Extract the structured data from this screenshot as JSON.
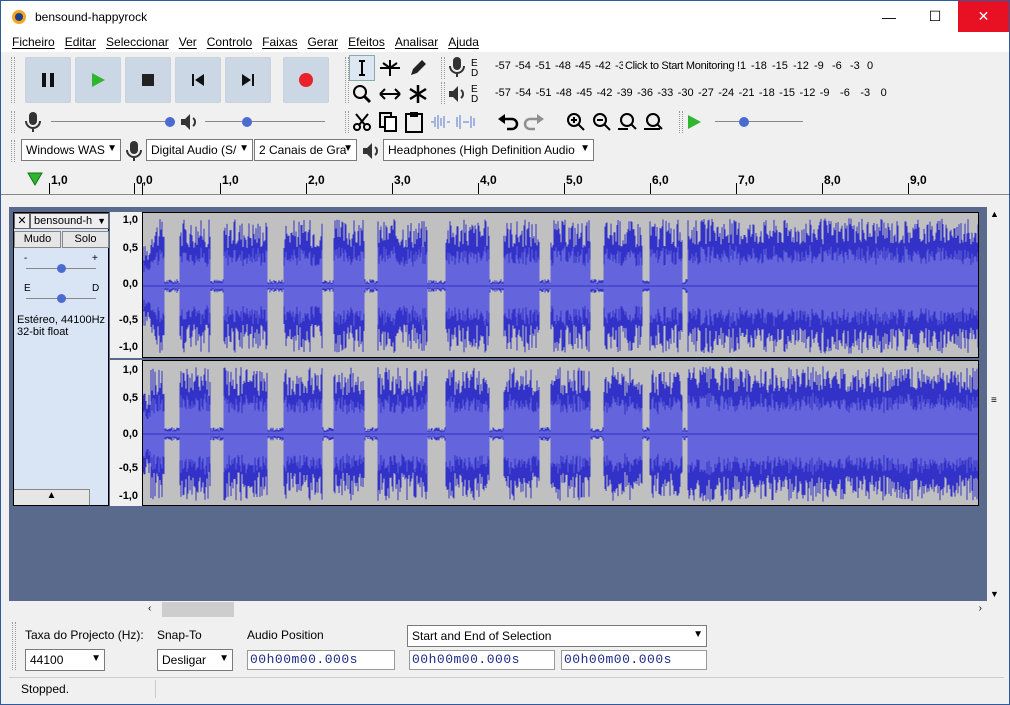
{
  "window": {
    "title": "bensound-happyrock",
    "minimize": "—",
    "maximize": "☐",
    "close": "✕"
  },
  "menu": [
    "Ficheiro",
    "Editar",
    "Seleccionar",
    "Ver",
    "Controlo",
    "Faixas",
    "Gerar",
    "Efeitos",
    "Analisar",
    "Ajuda"
  ],
  "meters": {
    "record_scale": [
      "-57",
      "-54",
      "-51",
      "-48",
      "-45",
      "-42",
      "-3"
    ],
    "record_monitor": "Click to Start Monitoring",
    "record_scale_right": [
      "!1",
      "-18",
      "-15",
      "-12",
      "-9",
      "-6",
      "-3",
      "0"
    ],
    "play_scale": [
      "-57",
      "-54",
      "-51",
      "-48",
      "-45",
      "-42",
      "-39",
      "-36",
      "-33",
      "-30",
      "-27",
      "-24",
      "-21",
      "-18",
      "-15",
      "-12",
      "-9",
      "-6",
      "-3",
      "0"
    ],
    "rec_label_top": "E",
    "rec_label_bottom": "D",
    "play_label_top": "E",
    "play_label_bottom": "D"
  },
  "devices": {
    "host": "Windows WAS",
    "input": "Digital Audio (S/",
    "channels": "2 Canais de Gra",
    "output": "Headphones (High Definition Audio"
  },
  "ruler": [
    "1,0",
    "0,0",
    "1,0",
    "2,0",
    "3,0",
    "4,0",
    "5,0",
    "6,0",
    "7,0",
    "8,0",
    "9,0"
  ],
  "track": {
    "name": "bensound-h",
    "mute": "Mudo",
    "solo": "Solo",
    "pan_left": "E",
    "pan_right": "D",
    "gain_minus": "-",
    "gain_plus": "+",
    "info_line1": "Estéreo, 44100Hz",
    "info_line2": "32-bit float",
    "scale": [
      "1,0",
      "0,5",
      "0,0",
      "-0,5",
      "-1,0"
    ]
  },
  "selection": {
    "rate_label": "Taxa do Projecto (Hz):",
    "rate_value": "44100",
    "snap_label": "Snap-To",
    "snap_value": "Desligar",
    "audio_pos_label": "Audio Position",
    "sel_mode": "Start and End of Selection",
    "time1": "00h00m00.000s",
    "time2": "00h00m00.000s",
    "time3": "00h00m00.000s"
  },
  "status": "Stopped.",
  "colors": {
    "wave": "#3232c8",
    "wave_rms": "#6464dc",
    "record": "#e8212a",
    "play": "#2fb52f"
  }
}
